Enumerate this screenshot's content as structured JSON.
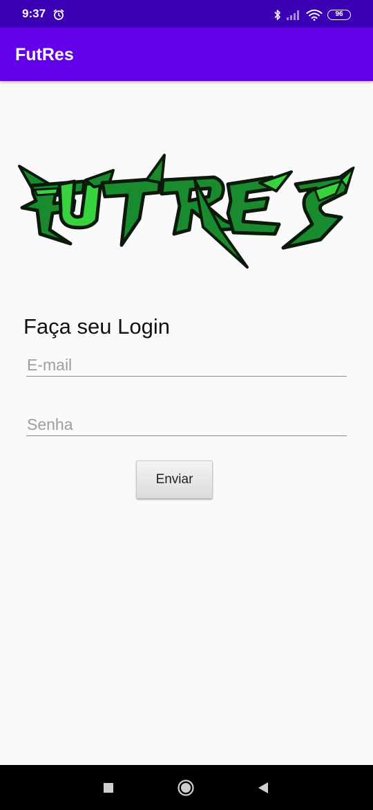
{
  "status_bar": {
    "time": "9:37",
    "battery": "96",
    "icons": [
      "alarm-icon",
      "bluetooth-icon",
      "cellular-signal-icon",
      "wifi-icon",
      "battery-icon"
    ]
  },
  "app_bar": {
    "title": "FutRes"
  },
  "logo": {
    "text": "FutRes",
    "colors": {
      "dark_green": "#1a8a2e",
      "light_green": "#39d23f",
      "outline": "#0b1a0b"
    }
  },
  "login": {
    "heading": "Faça seu Login",
    "email_placeholder": "E-mail",
    "email_value": "",
    "password_placeholder": "Senha",
    "password_value": "",
    "submit_label": "Enviar"
  },
  "nav_bar": {
    "buttons": [
      "recents-icon",
      "home-icon",
      "back-icon"
    ]
  },
  "colors": {
    "status_bar": "#3b00b3",
    "app_bar": "#6200ea",
    "background": "#fafafa"
  }
}
